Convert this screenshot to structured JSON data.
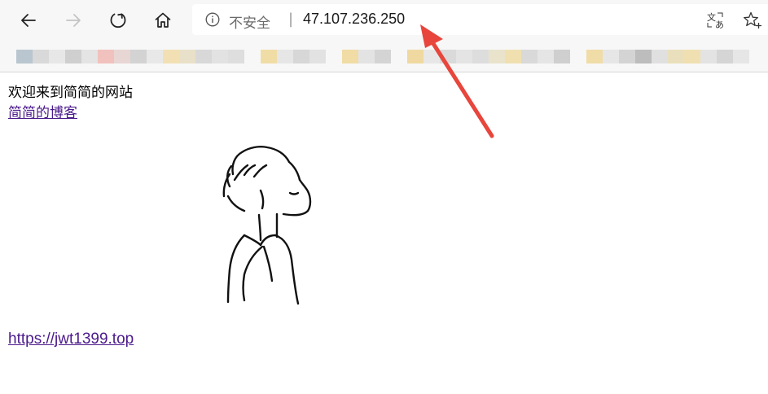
{
  "toolbar": {
    "back_icon": "arrow-left-icon",
    "forward_icon": "arrow-right-icon",
    "refresh_icon": "refresh-icon",
    "home_icon": "home-icon"
  },
  "address_bar": {
    "security_label": "不安全",
    "separator": "|",
    "url": "47.107.236.250",
    "info_icon": "info-icon",
    "translate_icon": "translate-icon",
    "favorite_icon": "star-plus-icon"
  },
  "page": {
    "welcome_text": "欢迎来到简简的网站",
    "blog_link": "简简的博客",
    "site_link": "https://jwt1399.top",
    "illustration": "line-drawing-boy"
  },
  "annotation": {
    "color": "#e8453c"
  },
  "colors": {
    "link": "#4b1a8c",
    "toolbar_bg": "#f7f7f7"
  }
}
